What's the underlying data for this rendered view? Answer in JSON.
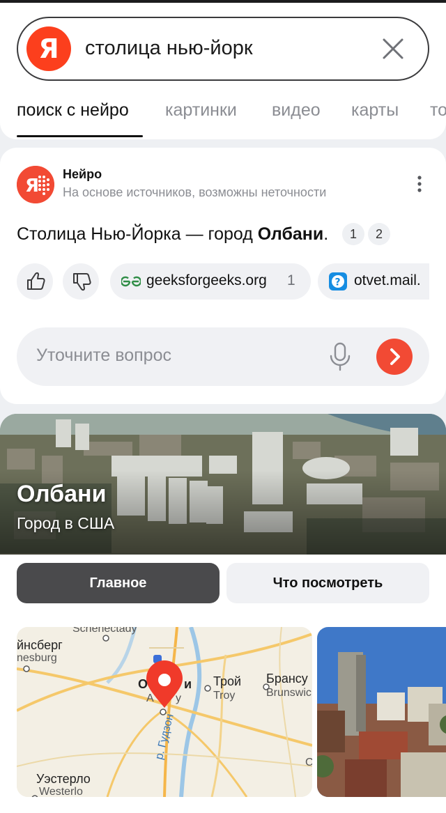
{
  "search": {
    "query": "столица нью-йорк",
    "logo_letter": "Я"
  },
  "tabs": [
    {
      "label": "поиск с нейро",
      "active": true
    },
    {
      "label": "картинки",
      "active": false
    },
    {
      "label": "видео",
      "active": false
    },
    {
      "label": "карты",
      "active": false
    },
    {
      "label": "то",
      "active": false
    }
  ],
  "neuro": {
    "name": "Нейро",
    "subtitle": "На основе источников, возможны неточности",
    "answer_prefix": "Столица Нью-Йорка — город ",
    "answer_bold": "Олбани",
    "answer_suffix": ".",
    "refs": [
      "1",
      "2"
    ],
    "sources": [
      {
        "label": "geeksforgeeks.org",
        "count": "1"
      },
      {
        "label": "otvet.mail."
      }
    ],
    "refine_placeholder": "Уточните вопрос"
  },
  "entity": {
    "title": "Олбани",
    "subtitle": "Город в США"
  },
  "segments": {
    "main": "Главное",
    "see": "Что посмотреть"
  },
  "map": {
    "labels": {
      "schenectady": "Schenectady",
      "ginsberg_ru": "йнсберг",
      "ginsberg_en": "nesburg",
      "albany_ru": "О",
      "albany_ru_b": "и",
      "albany_en": "A",
      "albany_en_b": "y",
      "troy_ru": "Трой",
      "troy_en": "Troy",
      "brunswick_ru": "Брансу",
      "brunswick_en": "Brunswic",
      "westerlo_ru": "Уэстерло",
      "westerlo_en": "Westerlo",
      "hudson": "р. Гудзон",
      "c": "C"
    }
  },
  "colors": {
    "accent": "#f24a34",
    "yandex_red": "#fc3f1d",
    "chip_bg": "#f0f1f4",
    "active_segment": "#4a4a4c"
  }
}
